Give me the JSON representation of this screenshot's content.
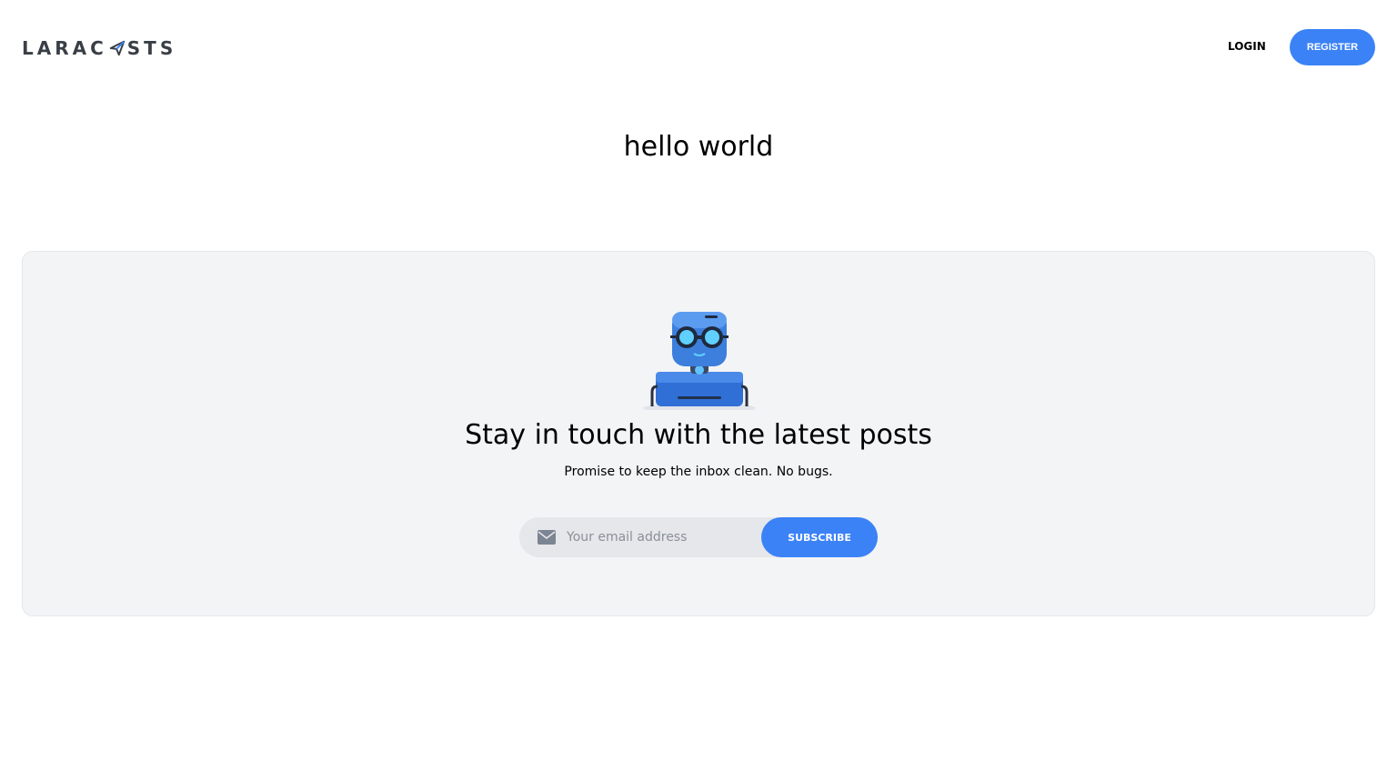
{
  "nav": {
    "logo_text_left": "LARAC",
    "logo_text_right": "STS",
    "logo_icon": "paper-plane-icon",
    "login_label": "LOGIN",
    "register_label": "REGISTER"
  },
  "main": {
    "title": "hello world"
  },
  "newsletter": {
    "mascot": "robot-mascot",
    "heading": "Stay in touch with the latest posts",
    "subheading": "Promise to keep the inbox clean. No bugs.",
    "email_placeholder": "Your email address",
    "email_icon": "mail-icon",
    "subscribe_label": "SUBSCRIBE"
  },
  "colors": {
    "accent": "#3b82f6",
    "panel_bg": "#f3f4f6",
    "input_bg": "#e5e7eb",
    "logo_text": "#3a3f47"
  }
}
